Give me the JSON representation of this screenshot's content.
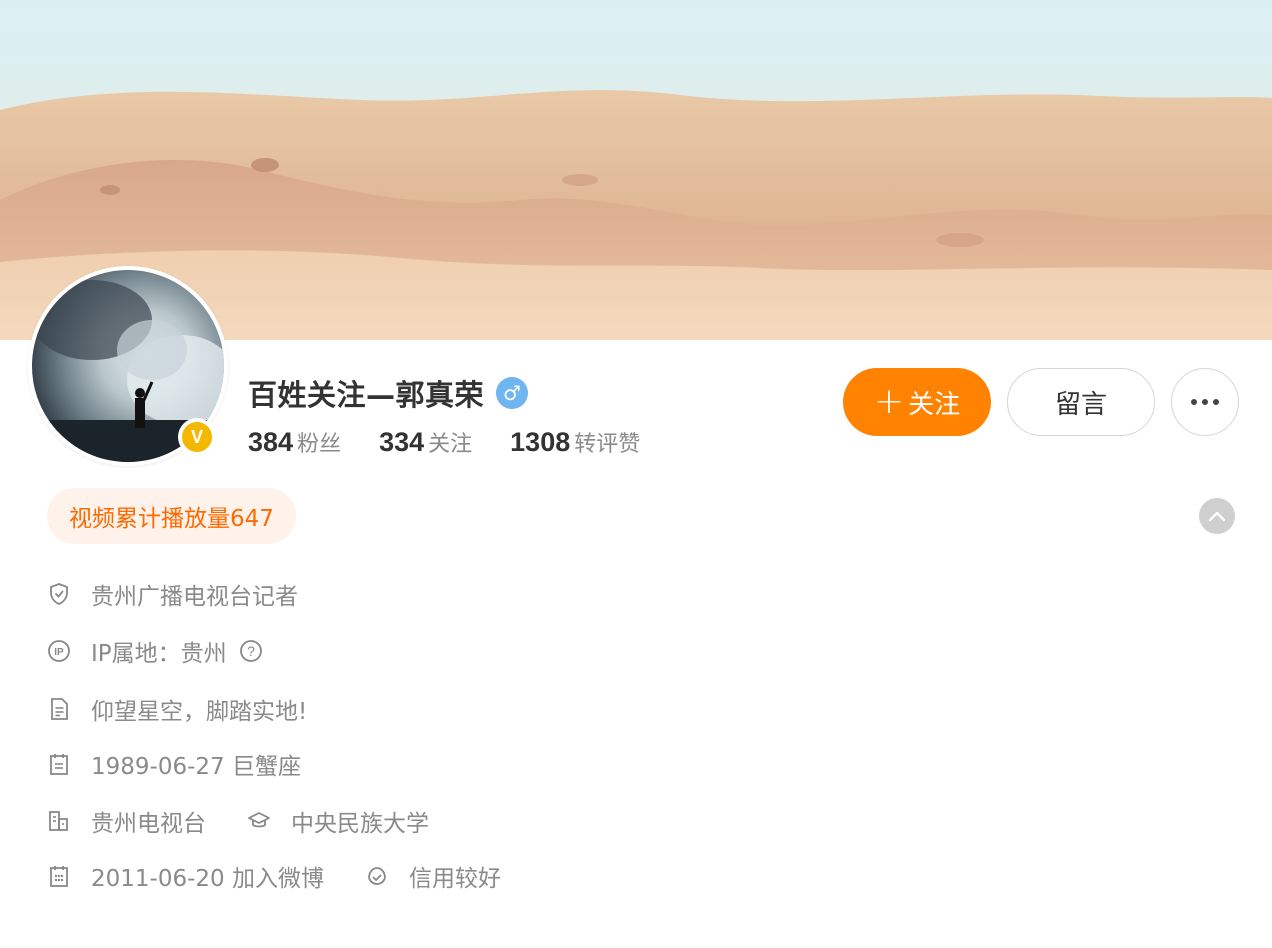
{
  "profile": {
    "name": "百姓关注—郭真荣",
    "gender_icon": "male-icon",
    "verified_badge_text": "V",
    "stats": [
      {
        "value": "384",
        "label": "粉丝"
      },
      {
        "value": "334",
        "label": "关注"
      },
      {
        "value": "1308",
        "label": "转评赞"
      }
    ]
  },
  "actions": {
    "follow_plus": "+",
    "follow_label": "关注",
    "message_label": "留言"
  },
  "video_tag": "视频累计播放量647",
  "info": {
    "title": "贵州广播电视台记者",
    "ip": "IP属地：贵州",
    "bio": "仰望星空，脚踏实地!",
    "birthday": "1989-06-27 巨蟹座",
    "company": "贵州电视台",
    "school": "中央民族大学",
    "joined": "2011-06-20 加入微博",
    "credit": "信用较好"
  },
  "colors": {
    "accent": "#ff8200",
    "tag_text": "#ff6a00",
    "tag_bg": "#fff2ea",
    "gender_male": "#6fb5ef",
    "verified": "#f5b800"
  }
}
